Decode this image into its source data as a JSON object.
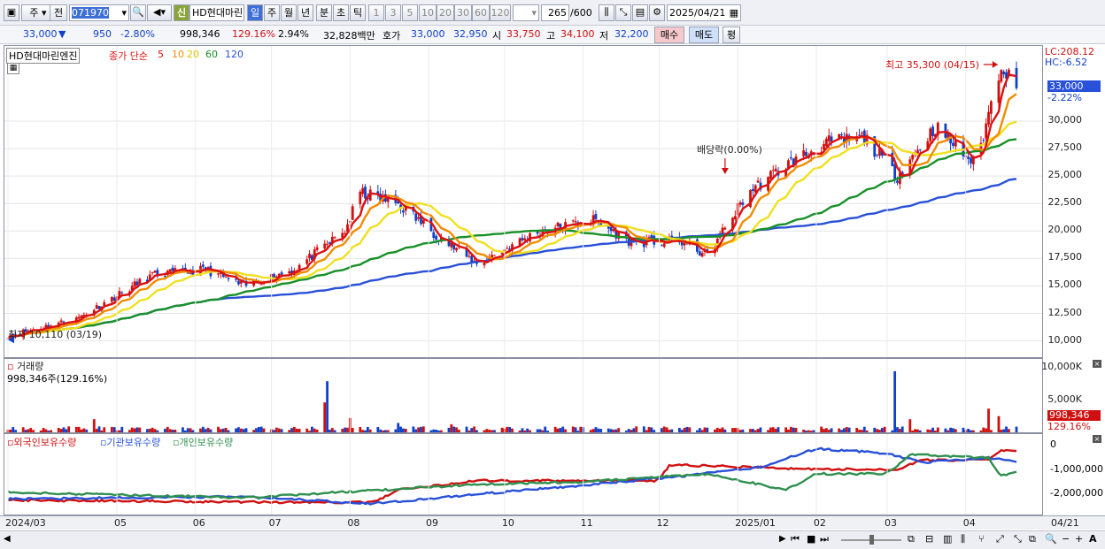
{
  "toolbar1": {
    "type": "주",
    "prev": "전",
    "code": "071970",
    "sin": "신",
    "name": "HD현대마린",
    "periods": [
      "일",
      "주",
      "월",
      "년",
      "분",
      "초",
      "틱"
    ],
    "active_period": "일",
    "nums": [
      "1",
      "3",
      "5",
      "10",
      "20",
      "30",
      "60",
      "120"
    ],
    "count": "265",
    "count_max": "/600",
    "date": "2025/04/21"
  },
  "toolbar2": {
    "price": "33,000",
    "arrow": "▼",
    "change": "950",
    "rate": "-2.80%",
    "volume": "998,346",
    "vol_rate": "129.16%",
    "turnover": "2.94%",
    "amount": "32,828백만",
    "hoga_label": "호가",
    "ask": "33,000",
    "bid": "32,950",
    "open_label": "시",
    "open": "33,750",
    "high_label": "고",
    "high": "34,100",
    "low_label": "저",
    "low": "32,200",
    "buy": "매수",
    "sell": "매도",
    "pyeong": "평"
  },
  "legend": {
    "name": "HD현대마린엔진",
    "ma_label": "종가 단순",
    "ma": [
      "5",
      "10",
      "20",
      "60",
      "120"
    ]
  },
  "annotations": {
    "high_note": "최고 35,300 (04/15)",
    "low_note": "최저 10,110 (03/19)",
    "dividend": "배당락(0.00%)",
    "lc": "LC:208.12",
    "hc": "HC:-6.52",
    "last_price": "33,000",
    "last_rate": "-2.22%"
  },
  "volume_panel": {
    "title": "거래량",
    "value": "998,346주(129.16%)",
    "last": "998,346",
    "last_rate": "129.16%"
  },
  "holding_panel": {
    "items": [
      "외국인보유수량",
      "기관보유수량",
      "개인보유수량"
    ]
  },
  "x_axis": [
    "2024/03",
    "05",
    "06",
    "07",
    "08",
    "09",
    "10",
    "11",
    "12",
    "2025/01",
    "02",
    "03",
    "04"
  ],
  "x_right": "04/21",
  "colors": {
    "up": "#d01010",
    "down": "#1040c8",
    "ma5": "#dd1111",
    "ma10": "#f08c00",
    "ma20": "#f0e020",
    "ma60": "#189028",
    "ma120": "#2850d8",
    "foreign": "#d01010",
    "inst": "#2850d8",
    "indiv": "#2f8f4f"
  },
  "chart_data": [
    {
      "type": "line",
      "x": [
        "2024/03/19",
        "2024/04/15",
        "2024/05/15",
        "2024/06/05",
        "2024/06/20",
        "2024/07/10",
        "2024/07/30",
        "2024/08/05",
        "2024/08/20",
        "2024/09/05",
        "2024/09/20",
        "2024/10/15",
        "2024/11/05",
        "2024/11/20",
        "2024/12/10",
        "2024/12/20",
        "2025/01/05",
        "2025/01/20",
        "2025/02/05",
        "2025/02/20",
        "2025/03/05",
        "2025/03/20",
        "2025/04/05",
        "2025/04/15",
        "2025/04/21"
      ],
      "series": [
        {
          "name": "종가",
          "values": [
            10500,
            12000,
            16000,
            16500,
            15000,
            16500,
            20000,
            23500,
            22500,
            19500,
            17000,
            20000,
            21000,
            19000,
            19000,
            17800,
            23500,
            26000,
            28000,
            28500,
            25000,
            29500,
            26000,
            35300,
            33000
          ]
        }
      ],
      "yticks": [
        "10,000",
        "12,500",
        "15,000",
        "17,500",
        "20,000",
        "22,500",
        "25,000",
        "27,500",
        "30,000"
      ],
      "ylim": [
        9000,
        36200
      ]
    },
    {
      "type": "bar",
      "title": "거래량",
      "yticks": [
        "5,000K",
        "10,000K"
      ],
      "ylim": [
        0,
        10500
      ]
    },
    {
      "type": "line",
      "series": [
        {
          "name": "외국인보유수량"
        },
        {
          "name": "기관보유수량"
        },
        {
          "name": "개인보유수량"
        }
      ],
      "yticks": [
        "0",
        "-1,000,000",
        "-2,000,000"
      ]
    }
  ]
}
